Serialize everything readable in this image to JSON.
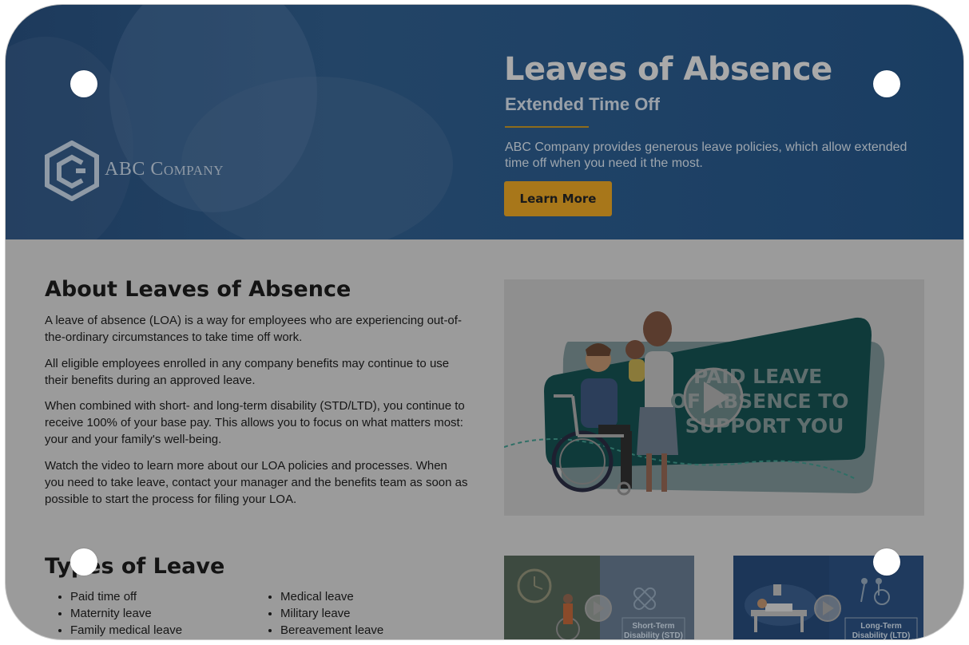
{
  "brand": {
    "logo_text": "ABC Company"
  },
  "hero": {
    "title": "Leaves of Absence",
    "subtitle": "Extended Time Off",
    "text": "ABC Company provides generous leave policies, which allow extended time off when you need it the most.",
    "cta_label": "Learn More"
  },
  "about": {
    "title": "About Leaves of Absence",
    "paragraphs": [
      "A leave of absence (LOA) is a way for employees who are experiencing out-of-the-ordinary circumstances to take time off work.",
      "All eligible employees enrolled in any company benefits may continue to use their benefits during an approved leave.",
      "When combined with short- and long-term disability (STD/LTD), you continue to receive 100% of your base pay. This allows you to focus on what matters most: your and your family's well-being.",
      "Watch the video to learn more about our LOA policies and processes. When you need to take leave, contact your manager and the benefits team as soon as possible to start the process for filing your LOA."
    ]
  },
  "video": {
    "banner_lines": [
      "PAID LEAVE",
      "OF ABSENCE TO",
      "SUPPORT YOU"
    ]
  },
  "types": {
    "title": "Types of Leave",
    "column1": [
      "Paid time off",
      "Maternity leave",
      "Family medical leave"
    ],
    "column2": [
      "Medical leave",
      "Military leave",
      "Bereavement leave"
    ]
  },
  "thumbnails": [
    {
      "label_line1": "Short-Term",
      "label_line2": "Disability (STD)"
    },
    {
      "label_line1": "Long-Term",
      "label_line2": "Disability (LTD)"
    }
  ],
  "colors": {
    "hero_bg": "#1f4266",
    "accent": "#a8771a",
    "overlay": "#9b9b9b"
  },
  "icons": [
    "abc-company-logo-icon",
    "play-icon",
    "clock-icon",
    "bandage-icon",
    "wheelchair-icon"
  ]
}
